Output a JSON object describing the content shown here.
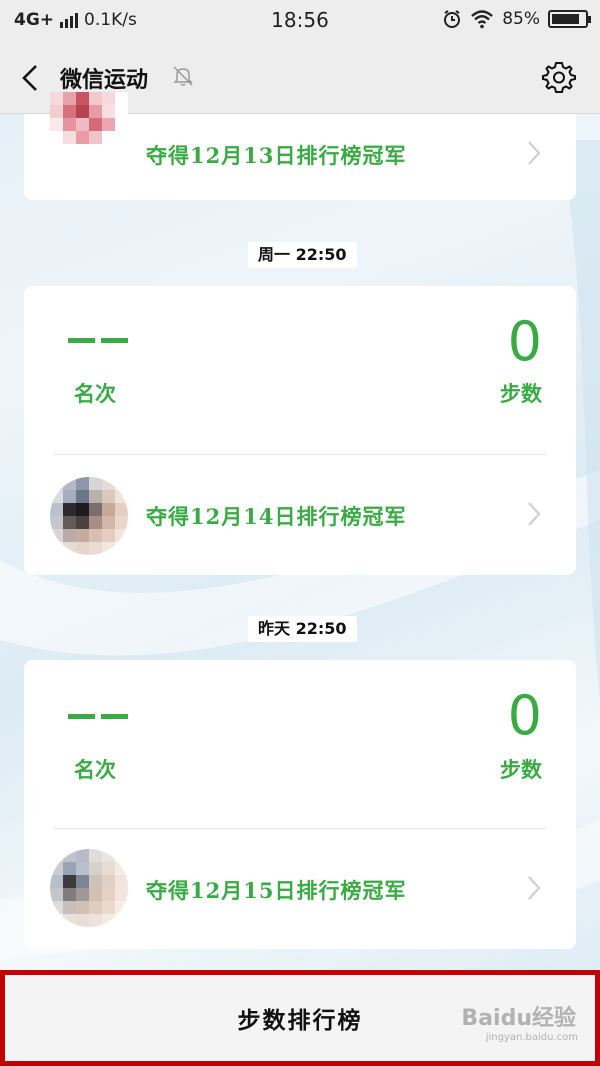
{
  "status_bar": {
    "network": "4G+",
    "speed": "0.1K/s",
    "time": "18:56",
    "battery": "85%",
    "battery_level": 0.85
  },
  "header": {
    "title": "微信运动",
    "back_icon": "chevron-left-icon",
    "mute_icon": "bell-off-icon",
    "settings_icon": "gear-icon"
  },
  "entries": [
    {
      "award_text": "夺得12月13日排行榜冠军"
    },
    {
      "time_label": "周一 22:50",
      "rank_label": "名次",
      "steps_value": "0",
      "steps_label": "步数",
      "award_text": "夺得12月14日排行榜冠军"
    },
    {
      "time_label": "昨天 22:50",
      "rank_label": "名次",
      "steps_value": "0",
      "steps_label": "步数",
      "award_text": "夺得12月15日排行榜冠军"
    }
  ],
  "bottom": {
    "button_label": "步数排行榜"
  },
  "watermark": {
    "text": "Baidu经验",
    "sub": "jingyan.baidu.com"
  },
  "colors": {
    "accent_green": "#3aab44",
    "highlight_red": "#c10000"
  }
}
